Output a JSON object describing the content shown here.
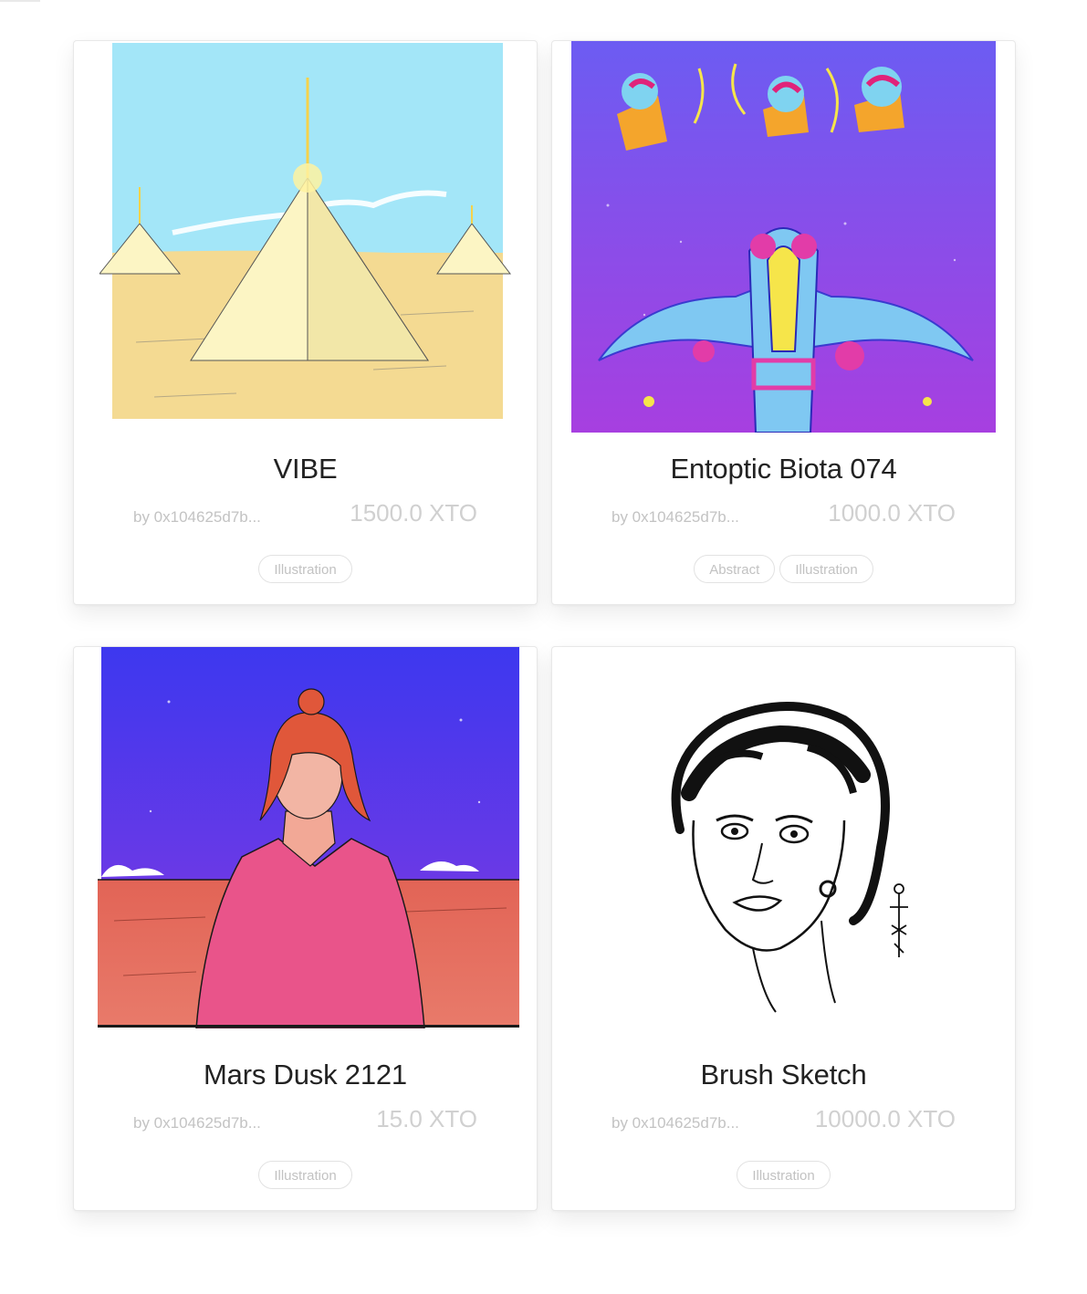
{
  "cards": [
    {
      "title": "VIBE",
      "author": "by 0x104625d7b...",
      "price": "1500.0 XTO",
      "tags": [
        "Illustration"
      ],
      "artwork": "desert-pyramids-artwork"
    },
    {
      "title": "Entoptic Biota 074",
      "author": "by 0x104625d7b...",
      "price": "1000.0 XTO",
      "tags": [
        "Abstract",
        "Illustration"
      ],
      "artwork": "psychedelic-creature-artwork"
    },
    {
      "title": "Mars Dusk 2121",
      "author": "by 0x104625d7b...",
      "price": "15.0 XTO",
      "tags": [
        "Illustration"
      ],
      "artwork": "woman-mars-desert-artwork"
    },
    {
      "title": "Brush Sketch",
      "author": "by 0x104625d7b...",
      "price": "10000.0 XTO",
      "tags": [
        "Illustration"
      ],
      "artwork": "ink-portrait-sketch-artwork"
    }
  ],
  "colors": {
    "title_text": "#222222",
    "muted_text": "#c3c3c3",
    "tag_border": "#e2e2e2",
    "card_border": "#e8e8e8"
  }
}
